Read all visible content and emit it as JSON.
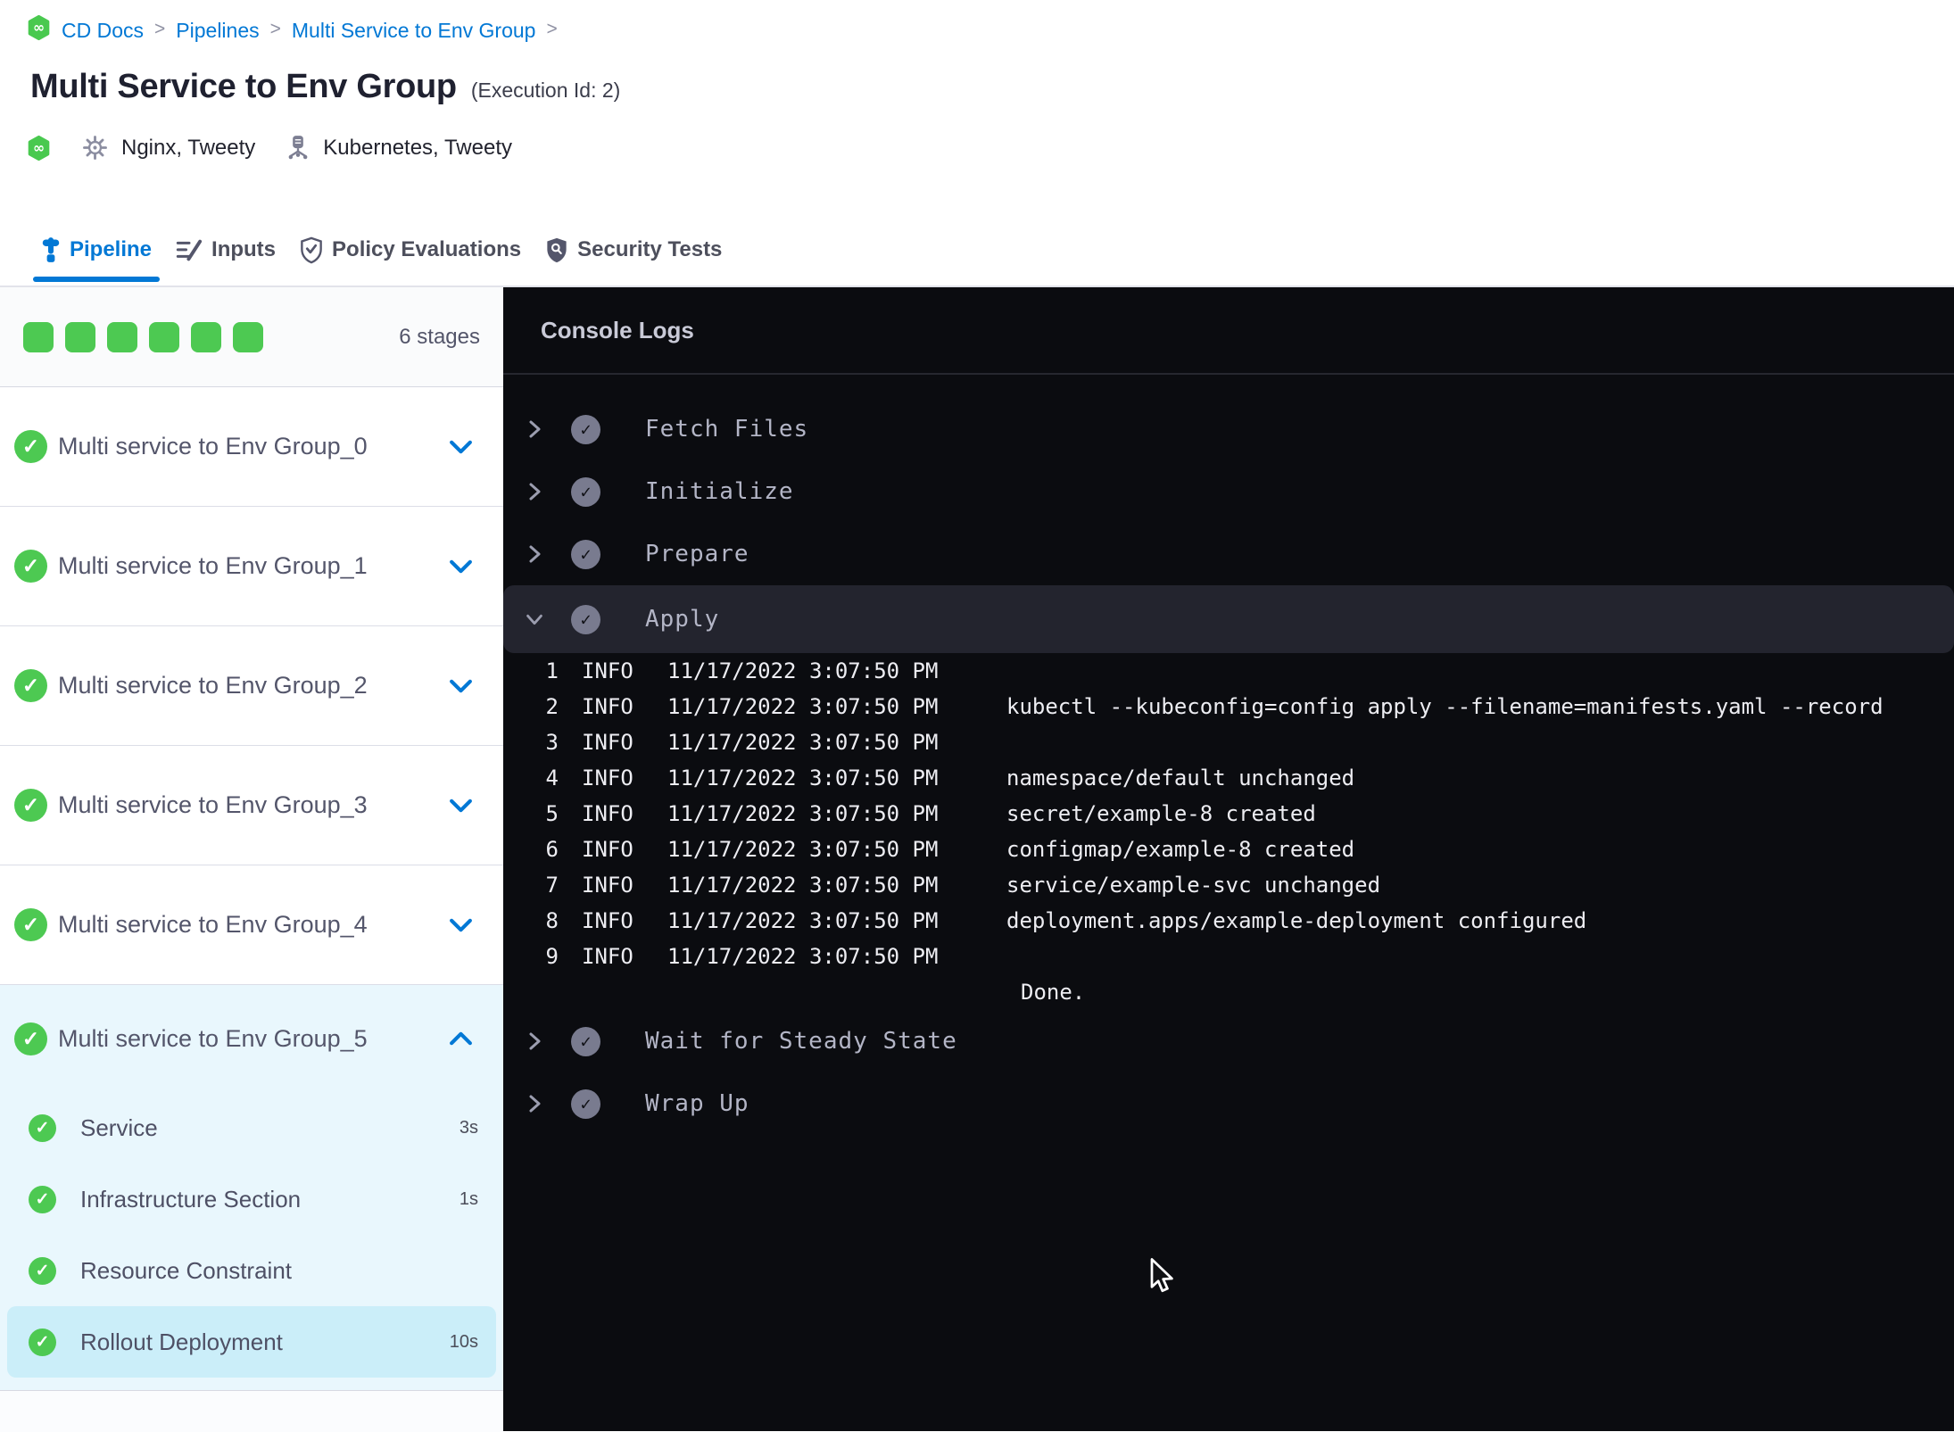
{
  "colors": {
    "accent_blue": "#0278d5",
    "success_green": "#4dc952",
    "console_bg": "#0b0c10",
    "apply_row_bg": "#23242e",
    "expanded_stage_bg": "#e9f7fd",
    "selected_step_bg": "#cbeef9"
  },
  "breadcrumb": {
    "items": [
      "CD Docs",
      "Pipelines",
      "Multi Service to Env Group"
    ],
    "separator": ">"
  },
  "header": {
    "title": "Multi Service to Env Group",
    "execution_id": "(Execution Id: 2)",
    "services_label": "Nginx, Tweety",
    "infrastructure_label": "Kubernetes, Tweety"
  },
  "tabs": [
    {
      "label": "Pipeline",
      "icon": "pipeline-icon",
      "active": true
    },
    {
      "label": "Inputs",
      "icon": "inputs-icon",
      "active": false
    },
    {
      "label": "Policy Evaluations",
      "icon": "policy-shield-icon",
      "active": false
    },
    {
      "label": "Security Tests",
      "icon": "security-shield-icon",
      "active": false
    }
  ],
  "sidebar": {
    "stage_status_squares": 6,
    "stages_count": "6 stages",
    "stages": [
      {
        "label": "Multi service to Env Group_0"
      },
      {
        "label": "Multi service to Env Group_1"
      },
      {
        "label": "Multi service to Env Group_2"
      },
      {
        "label": "Multi service to Env Group_3"
      },
      {
        "label": "Multi service to Env Group_4"
      }
    ],
    "expanded_stage": {
      "label": "Multi service to Env Group_5",
      "steps": [
        {
          "label": "Service",
          "duration": "3s",
          "selected": false
        },
        {
          "label": "Infrastructure Section",
          "duration": "1s",
          "selected": false
        },
        {
          "label": "Resource Constraint",
          "duration": "",
          "selected": false
        },
        {
          "label": "Rollout Deployment",
          "duration": "10s",
          "selected": true
        }
      ]
    }
  },
  "console": {
    "title": "Console Logs",
    "sections": [
      {
        "label": "Fetch Files",
        "expanded": false
      },
      {
        "label": "Initialize",
        "expanded": false
      },
      {
        "label": "Prepare",
        "expanded": false
      },
      {
        "label": "Apply",
        "expanded": true,
        "logs": [
          {
            "n": "1",
            "level": "INFO",
            "time": "11/17/2022 3:07:50 PM",
            "message": ""
          },
          {
            "n": "2",
            "level": "INFO",
            "time": "11/17/2022 3:07:50 PM",
            "message": "kubectl --kubeconfig=config apply --filename=manifests.yaml --record"
          },
          {
            "n": "3",
            "level": "INFO",
            "time": "11/17/2022 3:07:50 PM",
            "message": ""
          },
          {
            "n": "4",
            "level": "INFO",
            "time": "11/17/2022 3:07:50 PM",
            "message": "namespace/default unchanged"
          },
          {
            "n": "5",
            "level": "INFO",
            "time": "11/17/2022 3:07:50 PM",
            "message": "secret/example-8 created"
          },
          {
            "n": "6",
            "level": "INFO",
            "time": "11/17/2022 3:07:50 PM",
            "message": "configmap/example-8 created"
          },
          {
            "n": "7",
            "level": "INFO",
            "time": "11/17/2022 3:07:50 PM",
            "message": "service/example-svc unchanged"
          },
          {
            "n": "8",
            "level": "INFO",
            "time": "11/17/2022 3:07:50 PM",
            "message": "deployment.apps/example-deployment configured"
          },
          {
            "n": "9",
            "level": "INFO",
            "time": "11/17/2022 3:07:50 PM",
            "message": ""
          }
        ],
        "footer": "Done."
      },
      {
        "label": "Wait for Steady State",
        "expanded": false
      },
      {
        "label": "Wrap Up",
        "expanded": false
      }
    ]
  }
}
